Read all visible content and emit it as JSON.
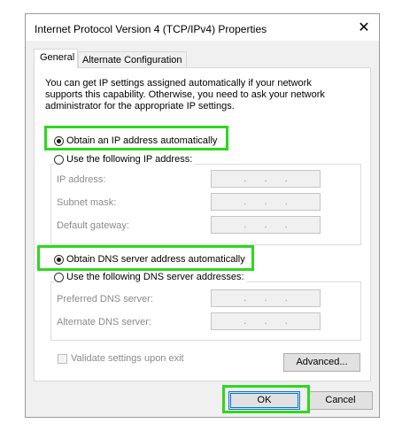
{
  "window": {
    "title": "Internet Protocol Version 4 (TCP/IPv4) Properties",
    "close_glyph": "✕"
  },
  "tabs": [
    {
      "label": "General",
      "active": true
    },
    {
      "label": "Alternate Configuration",
      "active": false
    }
  ],
  "general": {
    "description": "You can get IP settings assigned automatically if your network supports this capability. Otherwise, you need to ask your network administrator for the appropriate IP settings.",
    "ip_auto_label": "Obtain an IP address automatically",
    "ip_manual_label": "Use the following IP address:",
    "ip_fields": [
      {
        "label": "IP address:",
        "value": ".   .   ."
      },
      {
        "label": "Subnet mask:",
        "value": ".   .   ."
      },
      {
        "label": "Default gateway:",
        "value": ".   .   ."
      }
    ],
    "dns_auto_label": "Obtain DNS server address automatically",
    "dns_manual_label": "Use the following DNS server addresses:",
    "dns_fields": [
      {
        "label": "Preferred DNS server:",
        "value": ".   .   ."
      },
      {
        "label": "Alternate DNS server:",
        "value": ".   .   ."
      }
    ],
    "validate_label": "Validate settings upon exit",
    "advanced_label": "Advanced..."
  },
  "footer": {
    "ok_label": "OK",
    "cancel_label": "Cancel"
  },
  "colors": {
    "highlight": "#2ed81d",
    "focus_border": "#0078d7"
  }
}
